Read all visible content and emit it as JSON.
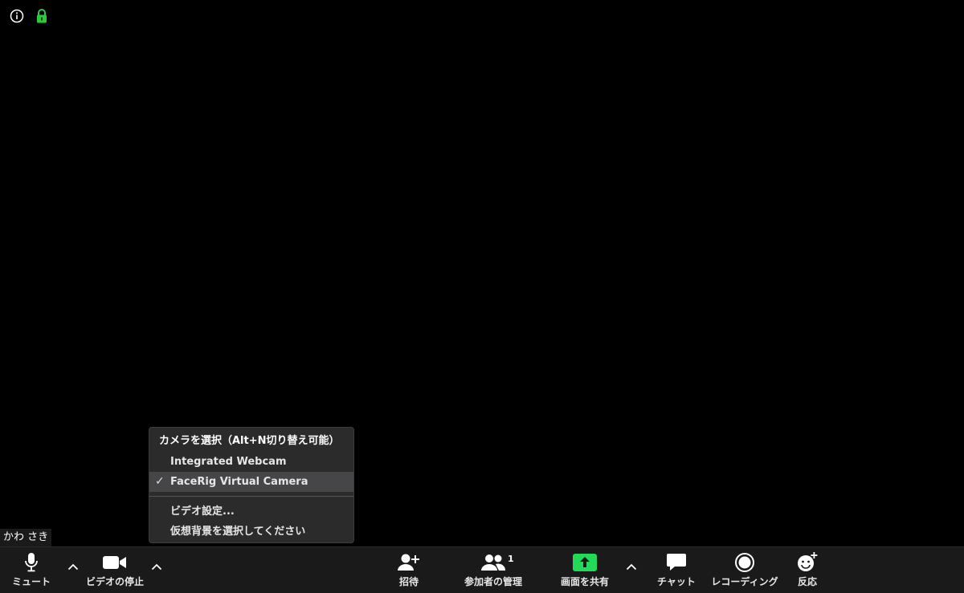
{
  "participant": {
    "name": "かわ さき"
  },
  "camera_menu": {
    "header": "カメラを選択（Alt+N切り替え可能）",
    "cameras": [
      {
        "label": "Integrated Webcam",
        "selected": false
      },
      {
        "label": "FaceRig Virtual Camera",
        "selected": true
      }
    ],
    "check_mark": "✓",
    "settings_label": "ビデオ設定...",
    "background_label": "仮想背景を選択してください"
  },
  "toolbar": {
    "mute_label": "ミュート",
    "stop_video_label": "ビデオの停止",
    "invite_label": "招待",
    "participants_label": "参加者の管理",
    "participants_count": "1",
    "share_label": "画面を共有",
    "chat_label": "チャット",
    "record_label": "レコーディング",
    "reactions_label": "反応"
  },
  "colors": {
    "background": "#000000",
    "toolbar": "#1a1a1a",
    "menu": "#2b2b2c",
    "share_green": "#23d959",
    "lock_green": "#2fc93c"
  },
  "icons": [
    "info-icon",
    "lock-icon",
    "mic-icon",
    "video-camera-icon",
    "caret-up-icon",
    "add-user-icon",
    "participants-icon",
    "share-screen-icon",
    "chat-icon",
    "record-icon",
    "reaction-icon"
  ]
}
